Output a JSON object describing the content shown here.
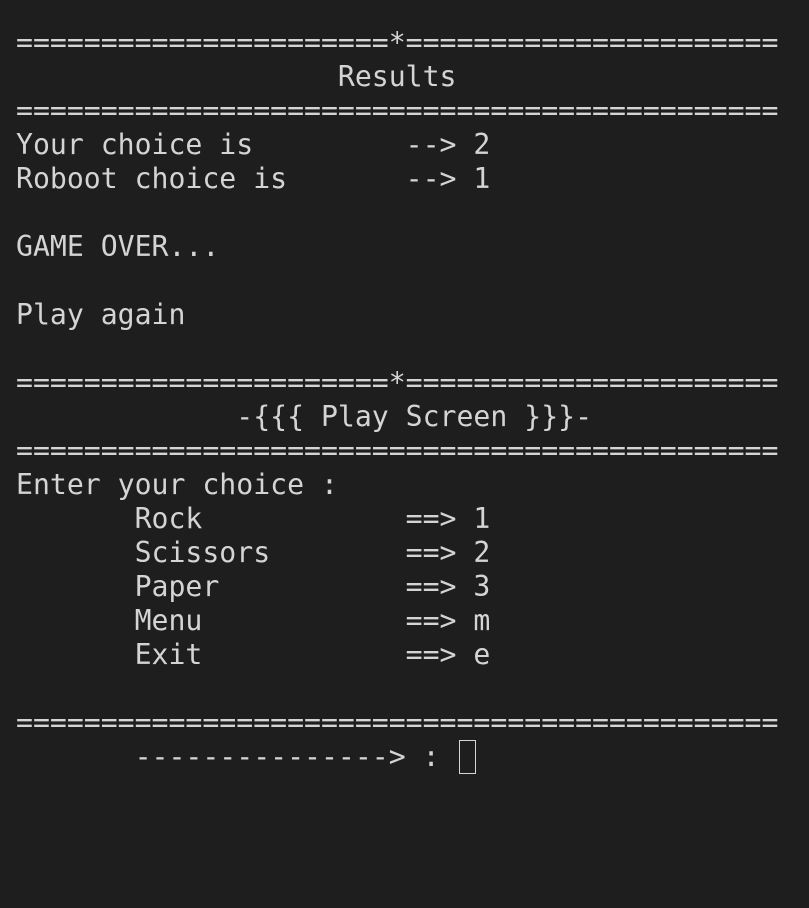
{
  "results": {
    "separator_top": "======================*======================",
    "title": "                   Results",
    "separator_bottom": "=============================================",
    "your_choice": "Your choice is         --> 2",
    "robot_choice": "Roboot choice is       --> 1",
    "game_over": "GAME OVER...",
    "play_again": "Play again"
  },
  "play_screen": {
    "separator_top": "======================*======================",
    "title": "             -{{{ Play Screen }}}-",
    "separator_bottom": "=============================================",
    "prompt": "Enter your choice :",
    "options": [
      "       Rock            ==> 1",
      "       Scissors        ==> 2",
      "       Paper           ==> 3",
      "       Menu            ==> m",
      "       Exit            ==> e"
    ],
    "separator_end": "=============================================",
    "input_prompt": "       ---------------> : "
  }
}
